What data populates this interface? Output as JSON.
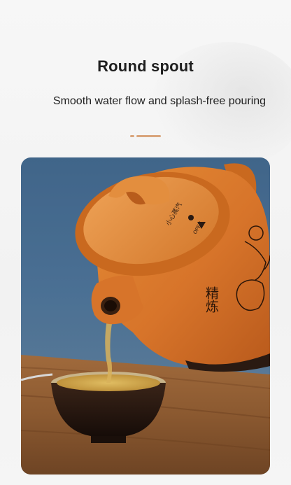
{
  "header": {
    "title": "Round spout",
    "subtitle": "Smooth water flow and splash-free pouring"
  },
  "photo": {
    "lid_text": "小心蒸汽",
    "open_text": "OPEN",
    "pot_text": "精炼",
    "colors": {
      "pot": "#d9782a",
      "background": "#4a6f93",
      "table": "#8a5a32",
      "bowl": "#2a1a12",
      "tea": "#c79a3c"
    }
  }
}
